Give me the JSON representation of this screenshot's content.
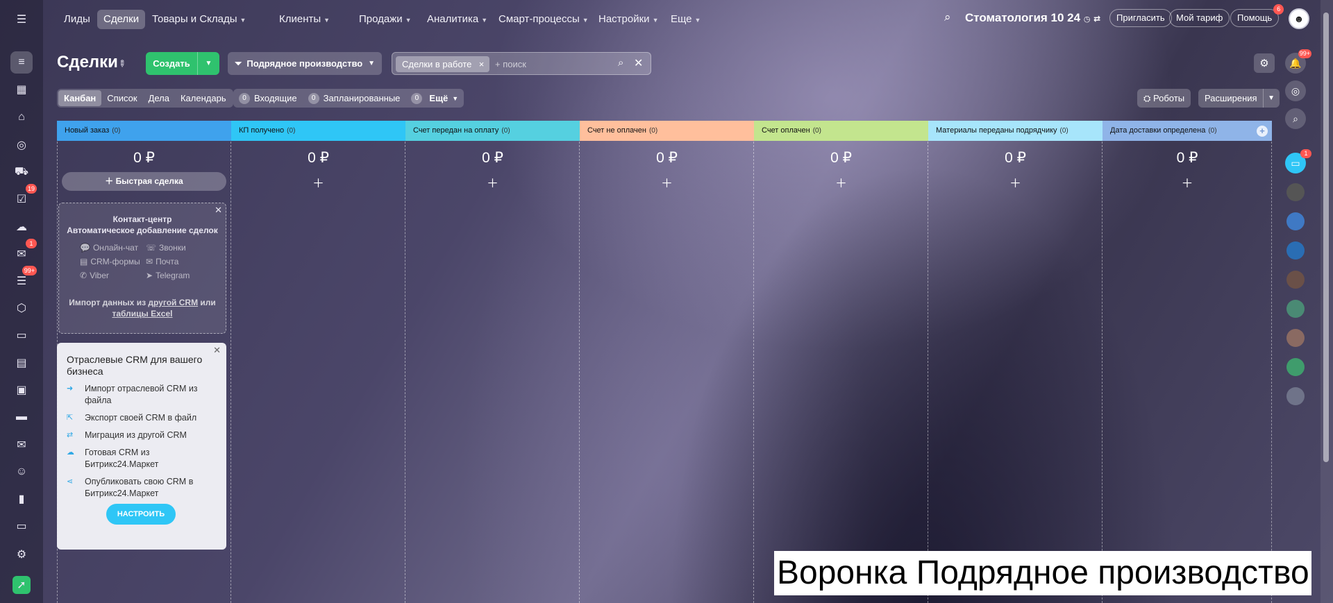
{
  "top_nav": {
    "items": [
      {
        "label": "Лиды",
        "chevron": false
      },
      {
        "label": "Сделки",
        "chevron": false,
        "active": true
      },
      {
        "label": "Товары и Склады",
        "chevron": true
      },
      {
        "label": "Клиенты",
        "chevron": true
      },
      {
        "label": "Продажи",
        "chevron": true
      },
      {
        "label": "Аналитика",
        "chevron": true
      },
      {
        "label": "Смарт-процессы",
        "chevron": true
      },
      {
        "label": "Настройки",
        "chevron": true
      },
      {
        "label": "Еще",
        "chevron": true
      }
    ],
    "company": "Стоматология 10 24",
    "invite": "Пригласить",
    "tariff": "Мой тариф",
    "help": "Помощь",
    "help_badge": "6"
  },
  "left_rail": {
    "badges": {
      "tasks": "19",
      "chat": "1",
      "feed": "99+"
    }
  },
  "header": {
    "title": "Сделки",
    "create_label": "Создать",
    "funnel_label": "Подрядное производство",
    "filter_chip": "Сделки в работе",
    "search_placeholder": "+ поиск"
  },
  "toolbar": {
    "views": [
      "Канбан",
      "Список",
      "Дела",
      "Календарь"
    ],
    "counters": [
      {
        "count": "0",
        "label": "Входящие"
      },
      {
        "count": "0",
        "label": "Запланированные"
      },
      {
        "count": "0",
        "label": "Ещё"
      }
    ],
    "robots": "Роботы",
    "extensions": "Расширения"
  },
  "stages": [
    {
      "name": "Новый заказ",
      "count": "(0)",
      "sum": "0 ₽",
      "color": "#3fa2ed"
    },
    {
      "name": "КП получено",
      "count": "(0)",
      "sum": "0 ₽",
      "color": "#2fc6f6"
    },
    {
      "name": "Счет передан на оплату",
      "count": "(0)",
      "sum": "0 ₽",
      "color": "#55d0e0"
    },
    {
      "name": "Счет не оплачен",
      "count": "(0)",
      "sum": "0 ₽",
      "color": "#ffa900"
    },
    {
      "name": "Счет оплачен",
      "count": "(0)",
      "sum": "0 ₽",
      "color": "#c3e58e"
    },
    {
      "name": "Материалы переданы подрядчику",
      "count": "(0)",
      "sum": "0 ₽",
      "color": "#a7e5fb"
    },
    {
      "name": "Дата доставки определена",
      "count": "(0)",
      "sum": "0 ₽",
      "color": "#8fb4e8"
    }
  ],
  "quick_deal": "Быстрая сделка",
  "contact_center": {
    "title_line1": "Контакт-центр",
    "title_line2": "Автоматическое добавление сделок",
    "channels": [
      "Онлайн-чат",
      "Звонки",
      "CRM-формы",
      "Почта",
      "Viber",
      "Telegram"
    ],
    "import_prefix": "Импорт данных из",
    "import_link1": "другой CRM",
    "import_mid": "или",
    "import_link2": "таблицы Excel"
  },
  "industry_card": {
    "title": "Отраслевые CRM для вашего бизнеса",
    "items": [
      "Импорт отраслевой CRM из файла",
      "Экспорт своей CRM в файл",
      "Миграция из другой CRM",
      "Готовая CRM из Битрикс24.Маркет",
      "Опубликовать свою CRM в Битрикс24.Маркет"
    ],
    "button": "НАСТРОИТЬ"
  },
  "right_rail": {
    "notif_badge": "99+",
    "chat_badge": "1"
  },
  "caption": "Воронка Подрядное производство"
}
